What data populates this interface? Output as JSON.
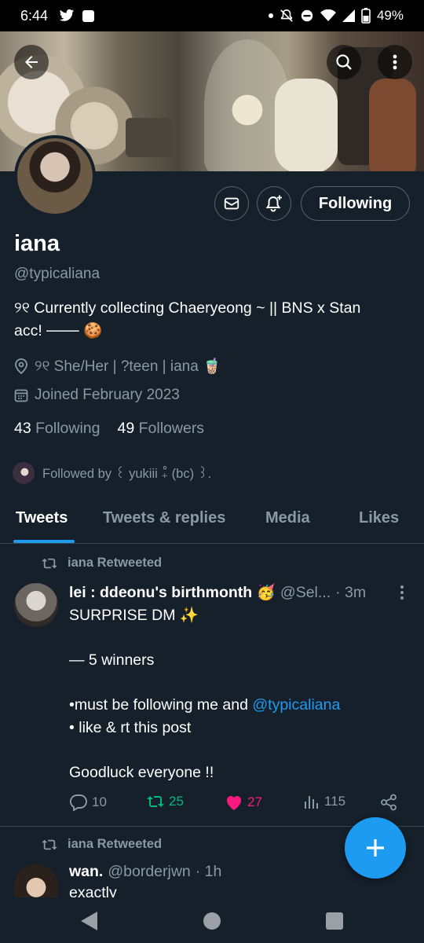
{
  "status_bar": {
    "time": "6:44",
    "battery": "49%"
  },
  "profile": {
    "name": "iana",
    "handle": "@typicaliana",
    "bio_line1": "୨୧ Currently collecting Chaeryeong ~ || BNS x Stan",
    "bio_line2": "acc! ─── 🍪",
    "location": "୨୧ She/Her | ?teen | iana 🧋",
    "joined": "Joined February 2023",
    "following_count": "43",
    "following_label": "Following",
    "followers_count": "49",
    "followers_label": "Followers",
    "followed_by": "Followed by ꒰ yukiii ₊̊ (bc) ꒱.",
    "follow_button": "Following"
  },
  "tabs": [
    "Tweets",
    "Tweets & replies",
    "Media",
    "Likes"
  ],
  "tweets": [
    {
      "retweeted_by": "iana Retweeted",
      "display_name": "lei : ddeonu's birthmonth 🥳",
      "handle": "@Sel...",
      "time": "· 3m",
      "line1": "SURPRISE DM ✨",
      "line2": "— 5 winners",
      "line3_prefix": "•must be following me and ",
      "line3_mention": "@typicaliana",
      "line4": "• like & rt this post",
      "line5": "Goodluck everyone !!",
      "replies": "10",
      "retweets": "25",
      "likes": "27",
      "views": "115"
    },
    {
      "retweeted_by": "iana Retweeted",
      "display_name": "wan.",
      "handle": "@borderjwn",
      "time": "· 1h",
      "line1": "exactly"
    }
  ],
  "colors": {
    "background": "#15202b",
    "accent": "#1d9bf0",
    "retweet_green": "#00ba7c",
    "like_pink": "#f91880",
    "secondary_text": "#8b98a5"
  }
}
